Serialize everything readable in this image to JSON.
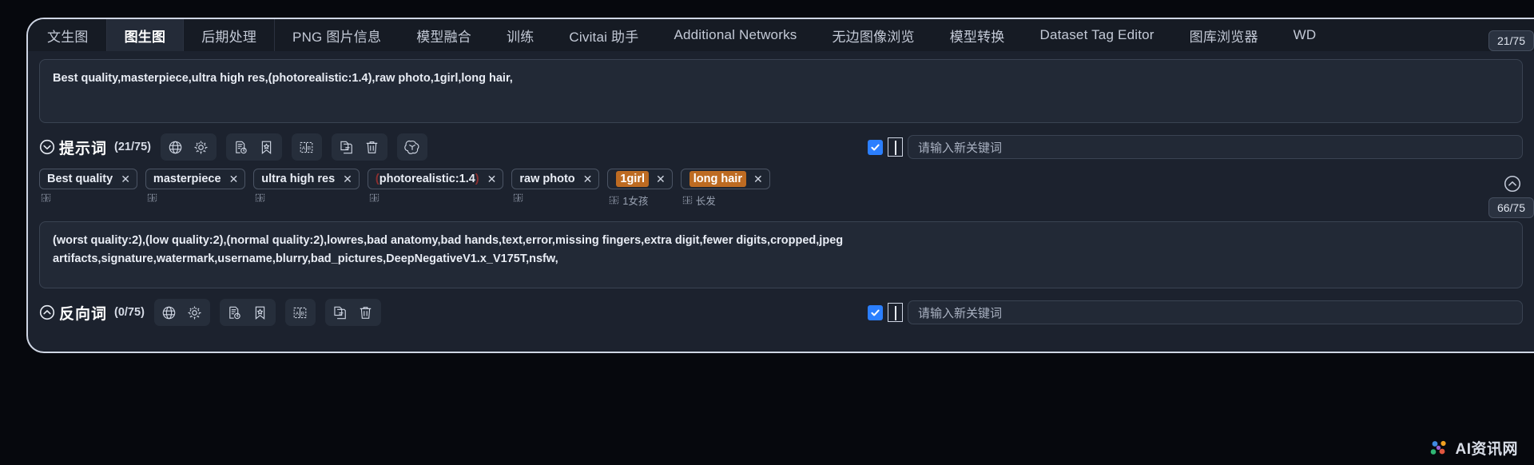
{
  "tabs": [
    {
      "label": "文生图",
      "active": false
    },
    {
      "label": "图生图",
      "active": true
    },
    {
      "label": "后期处理",
      "active": false
    },
    {
      "label": "PNG 图片信息",
      "active": false
    },
    {
      "label": "模型融合",
      "active": false
    },
    {
      "label": "训练",
      "active": false
    },
    {
      "label": "Civitai 助手",
      "active": false
    },
    {
      "label": "Additional Networks",
      "active": false
    },
    {
      "label": "无边图像浏览",
      "active": false
    },
    {
      "label": "模型转换",
      "active": false
    },
    {
      "label": "Dataset Tag Editor",
      "active": false
    },
    {
      "label": "图库浏览器",
      "active": false
    },
    {
      "label": "WD",
      "active": false
    }
  ],
  "prompt": {
    "text": "Best quality,masterpiece,ultra high res,(photorealistic:1.4),raw photo,1girl,long hair,",
    "counter": "21/75"
  },
  "positive_section": {
    "title": "提示词",
    "count": "(21/75)",
    "toolbar_groups": [
      {
        "buttons": [
          {
            "icon": "globe-icon"
          },
          {
            "icon": "gear-icon"
          }
        ]
      },
      {
        "buttons": [
          {
            "icon": "history-icon"
          },
          {
            "icon": "bookmark-star-icon"
          }
        ]
      },
      {
        "buttons": [
          {
            "icon": "translate-icon"
          }
        ]
      },
      {
        "buttons": [
          {
            "icon": "copy-icon"
          },
          {
            "icon": "trash-icon"
          }
        ]
      },
      {
        "buttons": [
          {
            "icon": "openai-icon"
          }
        ]
      }
    ],
    "keyword_input": {
      "checked": true,
      "placeholder": "请输入新关键词"
    },
    "tags": [
      {
        "label": "Best quality",
        "highlight": false,
        "translation": ""
      },
      {
        "label": "masterpiece",
        "highlight": false,
        "translation": ""
      },
      {
        "label": "ultra high res",
        "highlight": false,
        "translation": ""
      },
      {
        "label": "(photorealistic:1.4)",
        "highlight": false,
        "paren": true,
        "translation": ""
      },
      {
        "label": "raw photo",
        "highlight": false,
        "translation": ""
      },
      {
        "label": "1girl",
        "highlight": true,
        "translation": "1女孩"
      },
      {
        "label": "long hair",
        "highlight": true,
        "translation": "长发"
      }
    ]
  },
  "negative_prompt": {
    "line1": "(worst quality:2),(low quality:2),(normal quality:2),lowres,bad anatomy,bad hands,text,error,missing fingers,extra digit,fewer digits,cropped,jpeg",
    "line2": "artifacts,signature,watermark,username,blurry,bad_pictures,DeepNegativeV1.x_V175T,nsfw,",
    "counter": "66/75"
  },
  "negative_section": {
    "title": "反向词",
    "count": "(0/75)",
    "toolbar_groups": [
      {
        "buttons": [
          {
            "icon": "globe-icon"
          },
          {
            "icon": "gear-icon"
          }
        ]
      },
      {
        "buttons": [
          {
            "icon": "history-icon"
          },
          {
            "icon": "bookmark-star-icon"
          }
        ]
      },
      {
        "buttons": [
          {
            "icon": "translate-icon"
          }
        ]
      },
      {
        "buttons": [
          {
            "icon": "copy-icon"
          },
          {
            "icon": "trash-icon"
          }
        ]
      }
    ],
    "keyword_input": {
      "checked": true,
      "placeholder": "请输入新关键词"
    }
  },
  "watermark": {
    "text": "AI资讯网"
  },
  "colors": {
    "accent_blue": "#2b7fff",
    "tag_highlight": "#bd6b22",
    "panel_bg": "#1c222e",
    "field_bg": "#222936",
    "border": "#3a4352"
  }
}
